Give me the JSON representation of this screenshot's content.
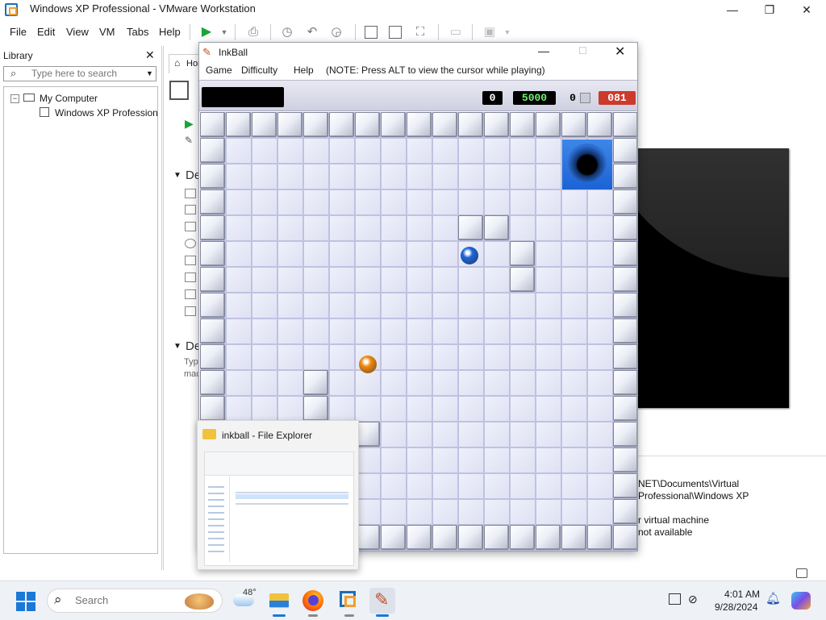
{
  "vmware": {
    "window_title": "Windows XP Professional - VMware Workstation",
    "menu": [
      "File",
      "Edit",
      "View",
      "VM",
      "Tabs",
      "Help"
    ],
    "library": {
      "header": "Library",
      "search_placeholder": "Type here to search",
      "tree": {
        "root": "My Computer",
        "child": "Windows XP Professional"
      }
    },
    "tab_label": "Hom",
    "left_sections": [
      "De",
      "De"
    ],
    "description_fragment": [
      "Typ",
      "mac"
    ],
    "details_lines": [
      "NET\\Documents\\Virtual",
      "Professional\\Windows XP",
      "r virtual machine",
      "not available"
    ]
  },
  "inkball": {
    "title": "InkBall",
    "menu": [
      "Game",
      "Difficulty",
      "Help"
    ],
    "note": "(NOTE: Press ALT to view the cursor while playing)",
    "counters": {
      "score": "0",
      "target": "5000",
      "balls_left": "0",
      "timer": "081"
    },
    "colors": {
      "board_bg": "#e3e5f4",
      "hole": "#2a71e0",
      "blue_ball": "#1e66d8",
      "orange_ball": "#f08a10",
      "timer_bg": "#cc3a2c",
      "target_fg": "#6ef26e"
    }
  },
  "thumbnail": {
    "title": "inkball - File Explorer"
  },
  "taskbar": {
    "search_placeholder": "Search",
    "weather": "48°",
    "time": "4:01 AM",
    "date": "9/28/2024",
    "icons": [
      "windows-start-icon",
      "weather-icon",
      "file-explorer-icon",
      "firefox-icon",
      "vmware-icon",
      "inkball-icon"
    ]
  }
}
